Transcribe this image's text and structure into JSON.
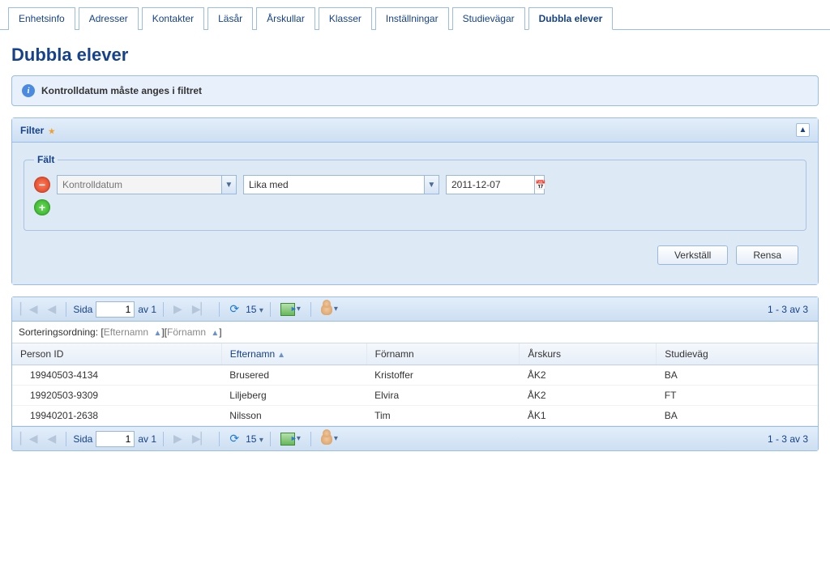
{
  "tabs": {
    "items": [
      {
        "label": "Enhetsinfo"
      },
      {
        "label": "Adresser"
      },
      {
        "label": "Kontakter"
      },
      {
        "label": "Läsår"
      },
      {
        "label": "Årskullar"
      },
      {
        "label": "Klasser"
      },
      {
        "label": "Inställningar"
      },
      {
        "label": "Studievägar"
      },
      {
        "label": "Dubbla elever"
      }
    ],
    "active_index": 8
  },
  "page_title": "Dubbla elever",
  "info_message": "Kontrolldatum måste anges i filtret",
  "filter_panel": {
    "title": "Filter",
    "fieldset_legend": "Fält",
    "row": {
      "field_value": "Kontrolldatum",
      "field_placeholder": "Kontrolldatum",
      "operator_value": "Lika med",
      "date_value": "2011-12-07"
    },
    "apply_label": "Verkställ",
    "reset_label": "Rensa"
  },
  "grid": {
    "paging": {
      "page_label_prefix": "Sida",
      "page_value": "1",
      "page_label_suffix": "av 1",
      "page_size": "15",
      "status": "1 - 3 av 3"
    },
    "sort": {
      "prefix": "Sorteringsordning:",
      "key1": "Efternamn",
      "key2": "Förnamn"
    },
    "columns": {
      "person_id": "Person ID",
      "lastname": "Efternamn",
      "firstname": "Förnamn",
      "grade": "Årskurs",
      "program": "Studieväg"
    },
    "rows": [
      {
        "person_id": "19940503-4134",
        "lastname": "Brusered",
        "firstname": "Kristoffer",
        "grade": "ÅK2",
        "program": "BA"
      },
      {
        "person_id": "19920503-9309",
        "lastname": "Liljeberg",
        "firstname": "Elvira",
        "grade": "ÅK2",
        "program": "FT"
      },
      {
        "person_id": "19940201-2638",
        "lastname": "Nilsson",
        "firstname": "Tim",
        "grade": "ÅK1",
        "program": "BA"
      }
    ]
  }
}
